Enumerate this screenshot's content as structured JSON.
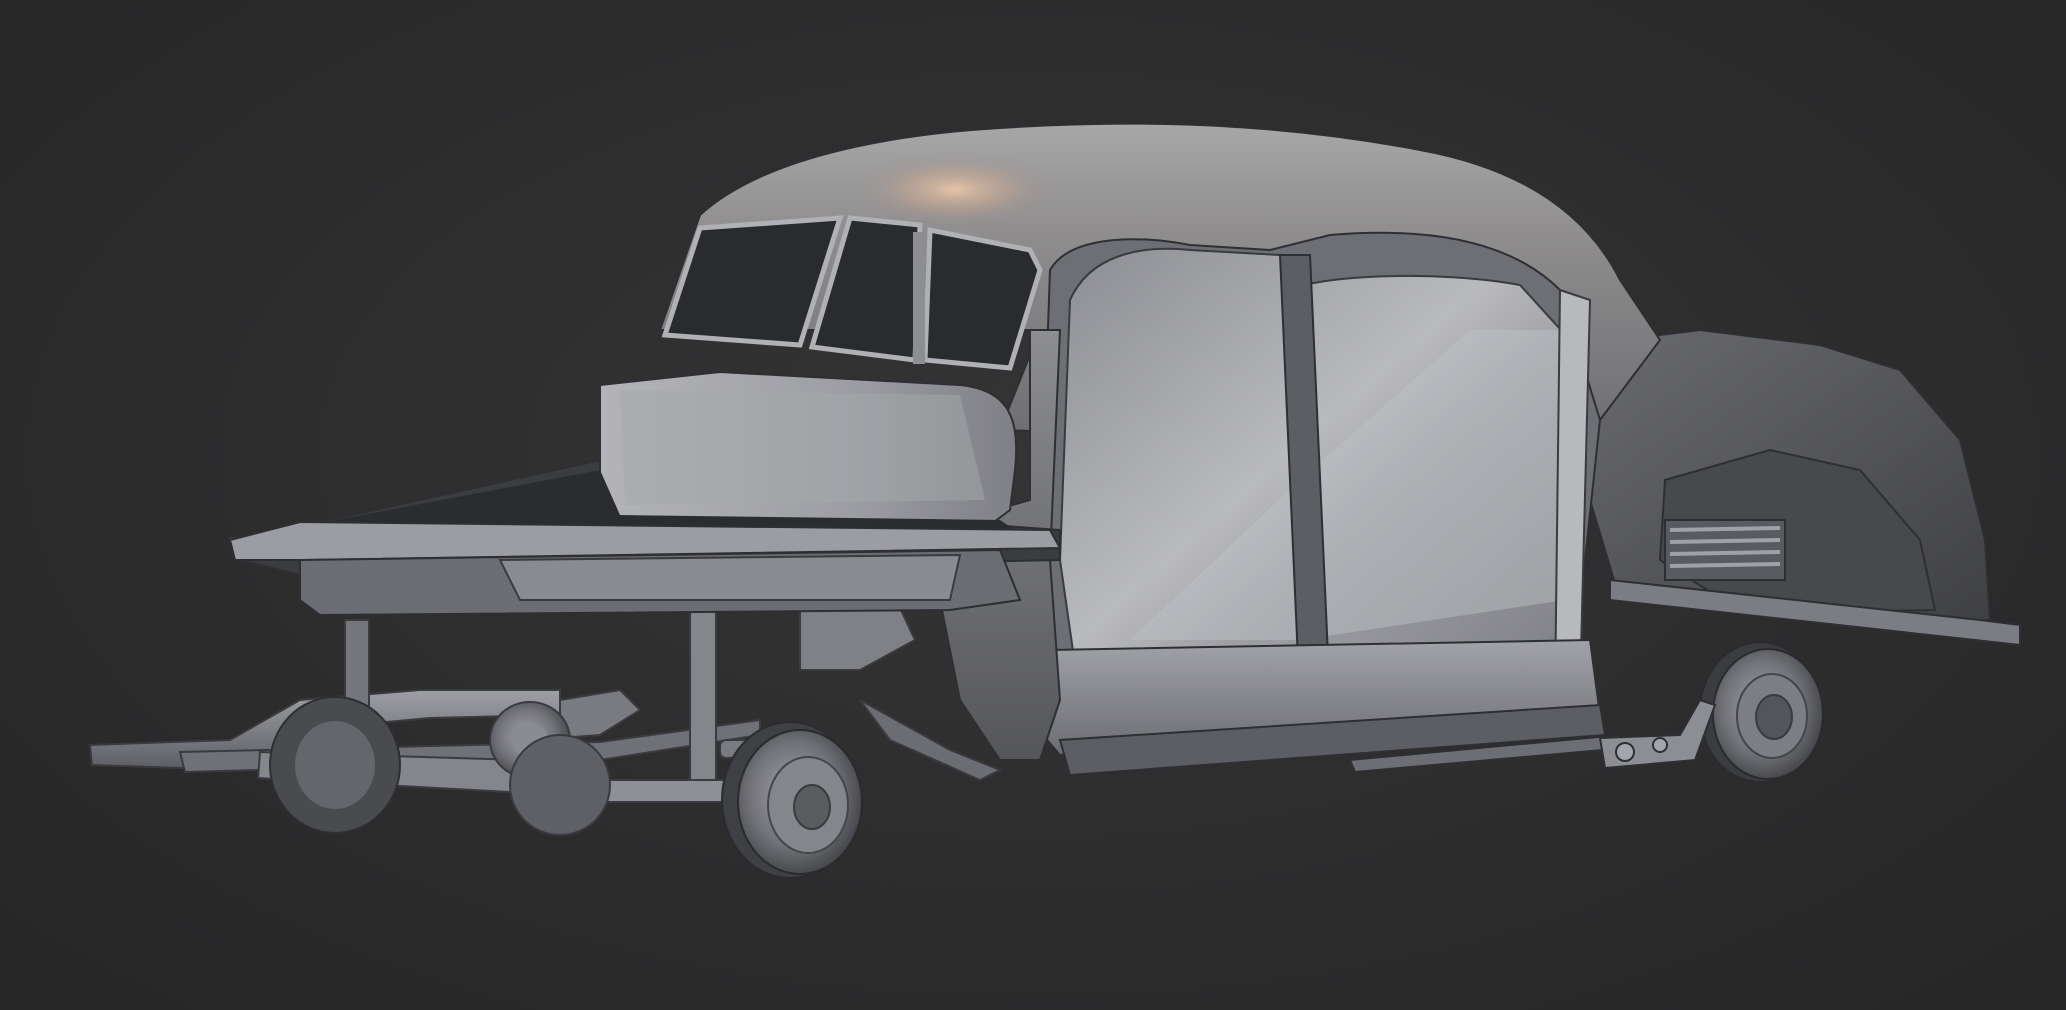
{
  "scene": {
    "subject": "car-body-model",
    "background_color": "#2d2d2e",
    "body_color": "#8e8f93",
    "highlight_color": "#e6c7ad"
  }
}
